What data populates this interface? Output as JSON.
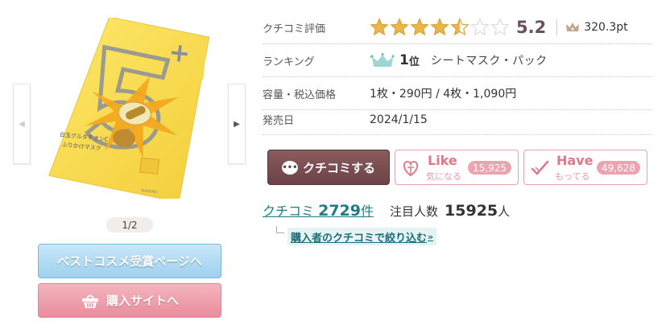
{
  "gallery": {
    "page_indicator": "1/2",
    "prev_arrow": "◀",
    "next_arrow": "▶",
    "product_label_text": "白玉グルタチオンC ふりかけマスク",
    "product_badge": "5+"
  },
  "buttons": {
    "best_cosme": "ベストコスメ受賞ページへ",
    "buy_site": "購入サイトへ"
  },
  "info": {
    "rating_label": "クチコミ評価",
    "rating_score": "5.2",
    "rating_stars": 4.5,
    "points": "320.3pt",
    "ranking_label": "ランキング",
    "ranking_number": "1",
    "ranking_suffix": "位",
    "ranking_category": "シートマスク・パック",
    "capacity_label": "容量・税込価格",
    "capacity_value": "1枚・290円 / 4枚・1,090円",
    "release_label": "発売日",
    "release_value": "2024/1/15"
  },
  "actions": {
    "kuchikomi": "クチコミする",
    "like_label": "Like",
    "like_sub": "気になる",
    "like_count": "15,925",
    "have_label": "Have",
    "have_sub": "もってる",
    "have_count": "49,628"
  },
  "reviews": {
    "link_prefix": "クチコミ",
    "count": "2729",
    "unit": "件",
    "attention_label": "注目人数",
    "attention_count": "15925",
    "attention_unit": "人",
    "filter_link": "購入者のクチコミで絞り込む",
    "filter_arrow": "»"
  },
  "colors": {
    "star_on": "#e8b64a",
    "star_off": "#dcdcdc",
    "kuchikomi_bg": "#6b4346",
    "like_accent": "#e07888",
    "link": "#1f7a8a",
    "best_btn": "#9fd0ee",
    "buy_btn": "#e98d9d"
  },
  "icons": {
    "crown": "crown-icon",
    "ranking_crown": "ranking-crown-icon",
    "speech_bubble": "speech-bubble-icon",
    "heart": "heart-icon",
    "check": "check-icon",
    "basket": "basket-icon"
  }
}
